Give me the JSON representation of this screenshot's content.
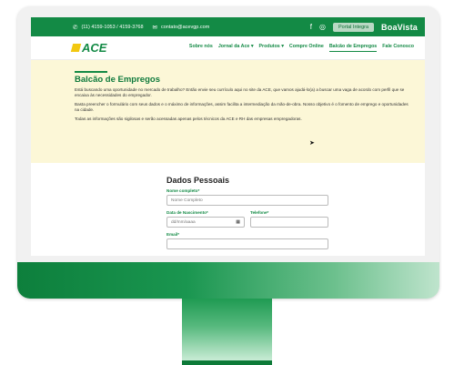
{
  "topbar": {
    "phone": "(11) 4159-1053 / 4159-3768",
    "email": "contato@acevgp.com",
    "portal_label": "Portal Integra",
    "partner": "BoaVista"
  },
  "logo": {
    "text": "ACE"
  },
  "nav": {
    "items": [
      {
        "label": "Sobre nós"
      },
      {
        "label": "Jornal da Ace ▾"
      },
      {
        "label": "Produtos ▾"
      },
      {
        "label": "Compre Online"
      },
      {
        "label": "Balcão de Empregos"
      },
      {
        "label": "Fale Conosco"
      }
    ],
    "active": "Balcão de Empregos"
  },
  "intro": {
    "title": "Balcão de Empregos",
    "p1": "Está buscando uma oportunidade no mercado de trabalho? Então envie seu currículo aqui no site da ACE, que vamos ajudá-lo(a) a buscar uma vaga de acordo com perfil que se encaixa às necessidades do empregador.",
    "p2": "Basta preencher o formulário com seus dados e o máximo de informações, assim facilita a intermediação da mão-de-obra. Nosso objetivo é o fomento de emprego e oportunidades na cidade.",
    "p3": "Todas as informações são sigilosas e serão acessadas apenas pelos técnicos da ACE e RH das empresas empregadoras."
  },
  "form": {
    "section_title": "Dados Pessoais",
    "name_label": "Nome completo*",
    "name_placeholder": "Nome Completo",
    "birth_label": "Data de Nascimento*",
    "birth_placeholder": "dd/mm/aaaa",
    "phone_label": "Telefone*",
    "email_label": "Email*"
  },
  "colors": {
    "brand_green": "#138a45",
    "accent_yellow": "#f2c811",
    "intro_bg": "#fcf7d7"
  }
}
